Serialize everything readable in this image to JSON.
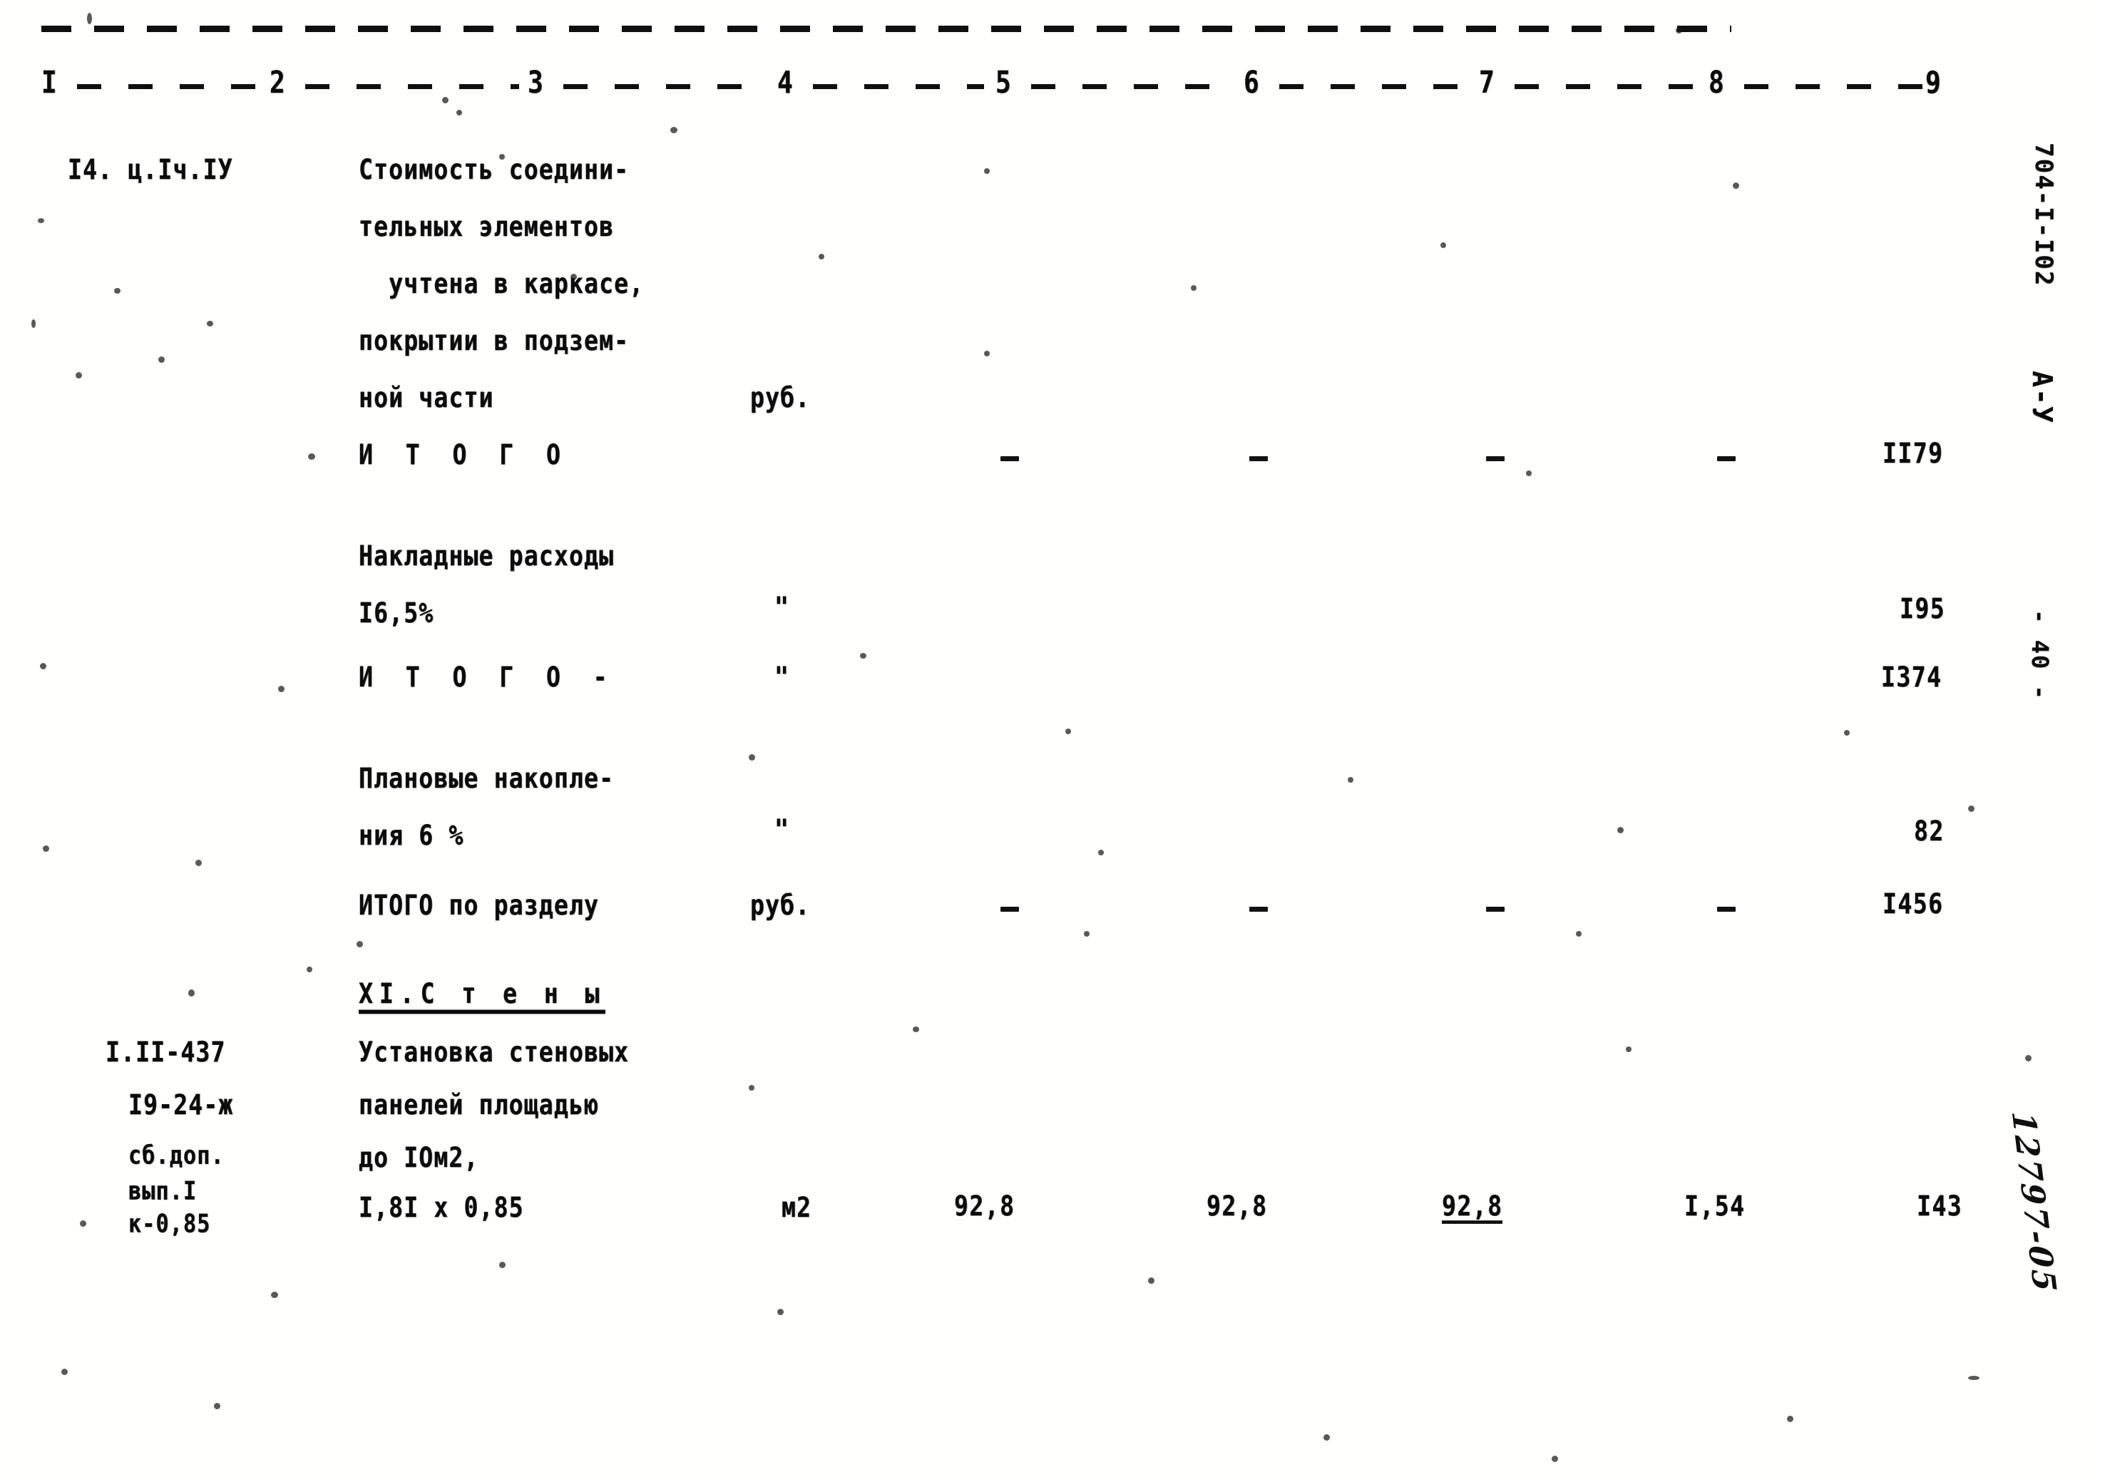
{
  "document": {
    "type": "construction-cost-estimate-sheet",
    "language": "ru",
    "margin_stamp_top": "704-I-I02",
    "margin_stamp_series": "А-У",
    "margin_stamp_page": "- 40 -",
    "margin_handwritten_number": "12797-05"
  },
  "table": {
    "column_numbers": [
      "I",
      "2",
      "3",
      "4",
      "5",
      "6",
      "7",
      "8",
      "9"
    ],
    "rows": [
      {
        "id": "row-14",
        "code_lines": [
          "I4. ц.Iч.IУ"
        ],
        "description_lines": [
          "Стоимость соедини-",
          "тельных элементов",
          "  учтена в каркасе,",
          "покрытии в подзем-",
          "ной части"
        ],
        "unit": "руб.",
        "col5": "",
        "col6": "",
        "col7": "",
        "col8": "",
        "col9": ""
      },
      {
        "id": "row-itogo-1",
        "code_lines": [],
        "description_lines": [
          "И Т О Г О"
        ],
        "unit": "",
        "col5": "-",
        "col6": "-",
        "col7": "-",
        "col8": "-",
        "col9": "II79"
      },
      {
        "id": "row-overhead",
        "code_lines": [],
        "description_lines": [
          "Накладные расходы",
          "I6,5%"
        ],
        "unit": "\"",
        "col5": "",
        "col6": "",
        "col7": "",
        "col8": "",
        "col9": "I95"
      },
      {
        "id": "row-itogo-2",
        "code_lines": [],
        "description_lines": [
          "И Т О Г О -"
        ],
        "unit": "\"",
        "col5": "",
        "col6": "",
        "col7": "",
        "col8": "",
        "col9": "I374"
      },
      {
        "id": "row-planned-savings",
        "code_lines": [],
        "description_lines": [
          "Плановые накопле-",
          "ния 6 %"
        ],
        "unit": "\"",
        "col5": "",
        "col6": "",
        "col7": "",
        "col8": "",
        "col9": "82"
      },
      {
        "id": "row-section-total",
        "code_lines": [],
        "description_lines": [
          "ИТОГО по разделу"
        ],
        "unit": "руб.",
        "col5": "-",
        "col6": "-",
        "col7": "-",
        "col8": "-",
        "col9": "I456"
      },
      {
        "id": "row-section-heading",
        "code_lines": [],
        "description_lines": [
          "XI.С т е н ы"
        ],
        "is_heading": true,
        "unit": "",
        "col5": "",
        "col6": "",
        "col7": "",
        "col8": "",
        "col9": ""
      },
      {
        "id": "row-wall-panels",
        "code_lines": [
          "I.II-437",
          "I9-24-ж",
          "сб.доп.",
          "вып.I",
          "к-0,85"
        ],
        "description_lines": [
          "Установка стеновых",
          "панелей площадью",
          "до IOм2,",
          "I,8I х 0,85"
        ],
        "unit": "м2",
        "col5": "92,8",
        "col6": "92,8",
        "col7": "92,8",
        "col8": "I,54",
        "col9": "I43"
      }
    ]
  }
}
